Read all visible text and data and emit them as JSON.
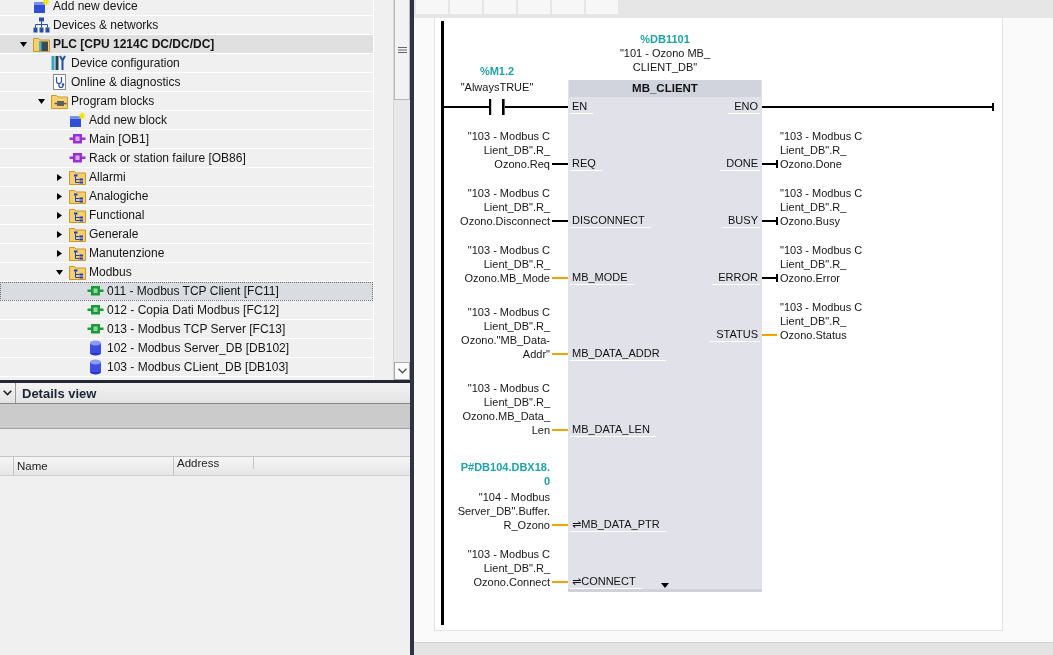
{
  "project_tree": {
    "items": [
      {
        "label": "Add new device",
        "kind": "add_device",
        "selected": false,
        "highlighted": false
      },
      {
        "label": "Devices & networks",
        "kind": "network",
        "selected": false,
        "highlighted": false
      },
      {
        "label": "PLC [CPU 1214C DC/DC/DC]",
        "kind": "plc",
        "selected": false,
        "highlighted": true,
        "expanded": true,
        "children": [
          {
            "label": "Device configuration",
            "kind": "device_config",
            "selected": false,
            "highlighted": false
          },
          {
            "label": "Online & diagnostics",
            "kind": "diagnostics",
            "selected": false,
            "highlighted": false
          },
          {
            "label": "Program blocks",
            "kind": "program_folder",
            "selected": false,
            "highlighted": false,
            "expanded": true,
            "children": [
              {
                "label": "Add new block",
                "kind": "add_block",
                "selected": false,
                "highlighted": false
              },
              {
                "label": "Main [OB1]",
                "kind": "ob",
                "selected": false,
                "highlighted": false
              },
              {
                "label": "Rack or station failure [OB86]",
                "kind": "ob",
                "selected": false,
                "highlighted": false
              },
              {
                "label": "Allarmi",
                "kind": "group",
                "selected": false,
                "highlighted": false,
                "expanded": false
              },
              {
                "label": "Analogiche",
                "kind": "group",
                "selected": false,
                "highlighted": false,
                "expanded": false
              },
              {
                "label": "Functional",
                "kind": "group",
                "selected": false,
                "highlighted": false,
                "expanded": false
              },
              {
                "label": "Generale",
                "kind": "group",
                "selected": false,
                "highlighted": false,
                "expanded": false
              },
              {
                "label": "Manutenzione",
                "kind": "group",
                "selected": false,
                "highlighted": false,
                "expanded": false
              },
              {
                "label": "Modbus",
                "kind": "group",
                "selected": false,
                "highlighted": false,
                "expanded": true,
                "children": [
                  {
                    "label": "011 - Modbus TCP Client [FC11]",
                    "kind": "fc",
                    "selected": true,
                    "highlighted": false
                  },
                  {
                    "label": "012 - Copia Dati Modbus [FC12]",
                    "kind": "fc",
                    "selected": false,
                    "highlighted": false
                  },
                  {
                    "label": "013 - Modbus TCP Server [FC13]",
                    "kind": "fc",
                    "selected": false,
                    "highlighted": false
                  },
                  {
                    "label": "102 - Modbus Server_DB [DB102]",
                    "kind": "db",
                    "selected": false,
                    "highlighted": false
                  },
                  {
                    "label": "103 - Modbus CLient_DB [DB103]",
                    "kind": "db",
                    "selected": false,
                    "highlighted": false
                  }
                ]
              }
            ]
          }
        ]
      }
    ]
  },
  "details_view": {
    "title": "Details view",
    "columns": [
      "Name",
      "Address"
    ]
  },
  "network": {
    "contact": {
      "address": "%M1.2",
      "symbol": "\"AlwaysTRUE\""
    },
    "block": {
      "instance_address": "%DB1101",
      "instance_name": [
        "\"101 - Ozono MB_",
        "CLIENT_DB\""
      ],
      "title": "MB_CLIENT",
      "inputs": [
        {
          "pin": "EN",
          "kind": "enable"
        },
        {
          "pin": "REQ",
          "kind": "bool",
          "operand": [
            "\"103 - Modbus C",
            "Lient_DB\".R_",
            "Ozono.Req"
          ]
        },
        {
          "pin": "DISCONNECT",
          "kind": "bool",
          "operand": [
            "\"103 - Modbus C",
            "Lient_DB\".R_",
            "Ozono.Disconnect"
          ]
        },
        {
          "pin": "MB_MODE",
          "kind": "word",
          "operand": [
            "\"103 - Modbus C",
            "Lient_DB\".R_",
            "Ozono.MB_Mode"
          ]
        },
        {
          "pin": "MB_DATA_ADDR",
          "kind": "word",
          "operand": [
            "\"103 - Modbus C",
            "Lient_DB\".R_",
            "Ozono.\"MB_Data-",
            "Addr\""
          ]
        },
        {
          "pin": "MB_DATA_LEN",
          "kind": "word",
          "operand": [
            "\"103 - Modbus C",
            "Lient_DB\".R_",
            "Ozono.MB_Data_",
            "Len"
          ]
        },
        {
          "pin": "⇌MB_DATA_PTR",
          "kind": "word",
          "address": [
            "P#DB104.DBX18.",
            "0"
          ],
          "operand": [
            "\"104 - Modbus",
            "Server_DB\".Buffer.",
            "R_Ozono"
          ]
        },
        {
          "pin": "⇌CONNECT",
          "kind": "word",
          "operand": [
            "\"103 - Modbus C",
            "Lient_DB\".R_",
            "Ozono.Connect"
          ]
        }
      ],
      "outputs": [
        {
          "pin": "ENO",
          "kind": "enable"
        },
        {
          "pin": "DONE",
          "kind": "bool",
          "operand": [
            "\"103 - Modbus C",
            "Lient_DB\".R_",
            "Ozono.Done"
          ]
        },
        {
          "pin": "BUSY",
          "kind": "bool",
          "operand": [
            "\"103 - Modbus C",
            "Lient_DB\".R_",
            "Ozono.Busy"
          ]
        },
        {
          "pin": "ERROR",
          "kind": "bool",
          "operand": [
            "\"103 - Modbus C",
            "Lient_DB\".R_",
            "Ozono.Error"
          ]
        },
        {
          "pin": "STATUS",
          "kind": "word",
          "operand": [
            "\"103 - Modbus C",
            "Lient_DB\".R_",
            "Ozono.Status"
          ]
        }
      ]
    }
  }
}
